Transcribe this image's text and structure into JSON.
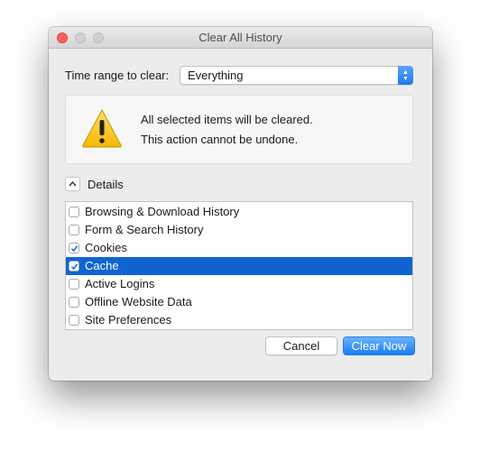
{
  "window": {
    "title": "Clear All History"
  },
  "time_range": {
    "label": "Time range to clear:",
    "selected": "Everything"
  },
  "warning": {
    "line1": "All selected items will be cleared.",
    "line2": "This action cannot be undone.",
    "icon": "warning-icon"
  },
  "details": {
    "label": "Details",
    "expanded": true
  },
  "items": [
    {
      "label": "Browsing & Download History",
      "checked": false,
      "selected": false
    },
    {
      "label": "Form & Search History",
      "checked": false,
      "selected": false
    },
    {
      "label": "Cookies",
      "checked": true,
      "selected": false
    },
    {
      "label": "Cache",
      "checked": true,
      "selected": true
    },
    {
      "label": "Active Logins",
      "checked": false,
      "selected": false
    },
    {
      "label": "Offline Website Data",
      "checked": false,
      "selected": false
    },
    {
      "label": "Site Preferences",
      "checked": false,
      "selected": false
    }
  ],
  "buttons": {
    "cancel": "Cancel",
    "clear_now": "Clear Now"
  },
  "colors": {
    "accent": "#1a7cf5",
    "selection": "#0f64d2",
    "close_button": "#fc605c",
    "warning_yellow": "#f5c400"
  }
}
